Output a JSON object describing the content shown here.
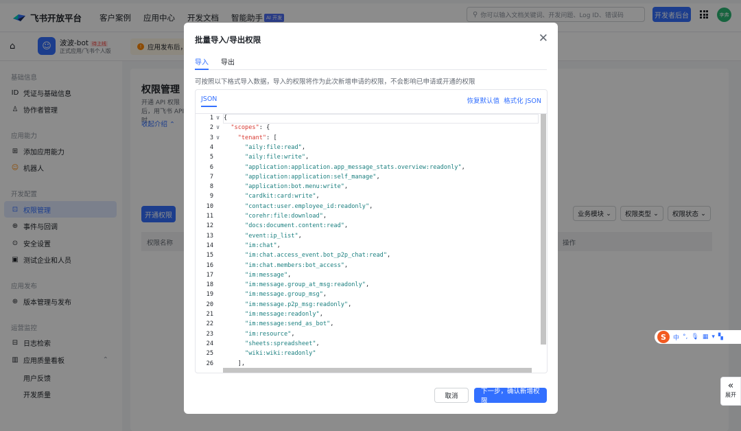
{
  "topbar": {
    "logo": "飞书开放平台",
    "nav": [
      "客户案例",
      "应用中心",
      "开发文档",
      "智能助手"
    ],
    "ai_badge": "AI 开发",
    "search_placeholder": "你可以输入文档关键词、开发问题、Log ID、错误码",
    "dev_console": "开发者后台",
    "avatar": "李弗"
  },
  "app": {
    "name": "波波-bot",
    "tag": "待上线",
    "subtitle": "正式应用/飞书个人版",
    "notice": "应用发布后，"
  },
  "sidebar": {
    "groups": [
      "基础信息",
      "应用能力",
      "开发配置",
      "应用发布",
      "运营监控"
    ],
    "items": [
      {
        "label": "凭证与基础信息",
        "icon": "ID"
      },
      {
        "label": "协作者管理",
        "icon": "♙"
      },
      {
        "label": "添加应用能力",
        "icon": "⊞"
      },
      {
        "label": "机器人",
        "icon": "☺"
      },
      {
        "label": "权限管理",
        "icon": "⊡"
      },
      {
        "label": "事件与回调",
        "icon": "⊕"
      },
      {
        "label": "安全设置",
        "icon": "⊙"
      },
      {
        "label": "测试企业和人员",
        "icon": "▣"
      },
      {
        "label": "版本管理与发布",
        "icon": "⊕"
      },
      {
        "label": "日志检索",
        "icon": "⊟"
      },
      {
        "label": "应用质量看板",
        "icon": "▥"
      }
    ],
    "subitems": [
      "用户反馈",
      "开发质量"
    ]
  },
  "main": {
    "title": "权限管理",
    "desc": "开通 API 权限后，用飞书 API 时，",
    "collapse": "收起介绍 ⌃",
    "open_button": "开通权限",
    "filters": [
      "业务模块",
      "权限类型",
      "权限状态"
    ],
    "col_name": "权限名称",
    "col_action": "操作"
  },
  "modal": {
    "title": "批量导入/导出权限",
    "tabs": [
      "导入",
      "导出"
    ],
    "desc": "可按照以下格式导入数据，导入的权限将作为此次新增申请的权限，不会影响已申请或开通的权限",
    "editor_tab": "JSON",
    "restore": "恢复默认值",
    "format": "格式化 JSON",
    "cancel": "取消",
    "confirm": "下一步，确认新增权限"
  },
  "code_lines": [
    {
      "n": "1",
      "fold": "∨",
      "pre": "",
      "text": "{",
      "kind": "pun"
    },
    {
      "n": "2",
      "fold": "∨",
      "pre": "  ",
      "key": "\"scopes\"",
      "text": ": {",
      "kind": "key"
    },
    {
      "n": "3",
      "fold": "∨",
      "pre": "    ",
      "key": "\"tenant\"",
      "text": ": [",
      "kind": "key"
    },
    {
      "n": "4",
      "pre": "      ",
      "text": "\"aily:file:read\",",
      "kind": "str"
    },
    {
      "n": "5",
      "pre": "      ",
      "text": "\"aily:file:write\",",
      "kind": "str"
    },
    {
      "n": "6",
      "pre": "      ",
      "text": "\"application:application.app_message_stats.overview:readonly\",",
      "kind": "str"
    },
    {
      "n": "7",
      "pre": "      ",
      "text": "\"application:application:self_manage\",",
      "kind": "str"
    },
    {
      "n": "8",
      "pre": "      ",
      "text": "\"application:bot.menu:write\",",
      "kind": "str"
    },
    {
      "n": "9",
      "pre": "      ",
      "text": "\"cardkit:card:write\",",
      "kind": "str"
    },
    {
      "n": "10",
      "pre": "      ",
      "text": "\"contact:user.employee_id:readonly\",",
      "kind": "str"
    },
    {
      "n": "11",
      "pre": "      ",
      "text": "\"corehr:file:download\",",
      "kind": "str"
    },
    {
      "n": "12",
      "pre": "      ",
      "text": "\"docs:document.content:read\",",
      "kind": "str"
    },
    {
      "n": "13",
      "pre": "      ",
      "text": "\"event:ip_list\",",
      "kind": "str"
    },
    {
      "n": "14",
      "pre": "      ",
      "text": "\"im:chat\",",
      "kind": "str"
    },
    {
      "n": "15",
      "pre": "      ",
      "text": "\"im:chat.access_event.bot_p2p_chat:read\",",
      "kind": "str"
    },
    {
      "n": "16",
      "pre": "      ",
      "text": "\"im:chat.members:bot_access\",",
      "kind": "str"
    },
    {
      "n": "17",
      "pre": "      ",
      "text": "\"im:message\",",
      "kind": "str"
    },
    {
      "n": "18",
      "pre": "      ",
      "text": "\"im:message.group_at_msg:readonly\",",
      "kind": "str"
    },
    {
      "n": "19",
      "pre": "      ",
      "text": "\"im:message.group_msg\",",
      "kind": "str"
    },
    {
      "n": "20",
      "pre": "      ",
      "text": "\"im:message.p2p_msg:readonly\",",
      "kind": "str"
    },
    {
      "n": "21",
      "pre": "      ",
      "text": "\"im:message:readonly\",",
      "kind": "str"
    },
    {
      "n": "22",
      "pre": "      ",
      "text": "\"im:message:send_as_bot\",",
      "kind": "str"
    },
    {
      "n": "23",
      "pre": "      ",
      "text": "\"im:resource\",",
      "kind": "str"
    },
    {
      "n": "24",
      "pre": "      ",
      "text": "\"sheets:spreadsheet\",",
      "kind": "str"
    },
    {
      "n": "25",
      "pre": "      ",
      "text": "\"wiki:wiki:readonly\"",
      "kind": "str"
    },
    {
      "n": "26",
      "pre": "    ",
      "text": "],",
      "kind": "pun"
    }
  ],
  "ime": {
    "label": "中"
  },
  "expand": {
    "label": "展开"
  }
}
